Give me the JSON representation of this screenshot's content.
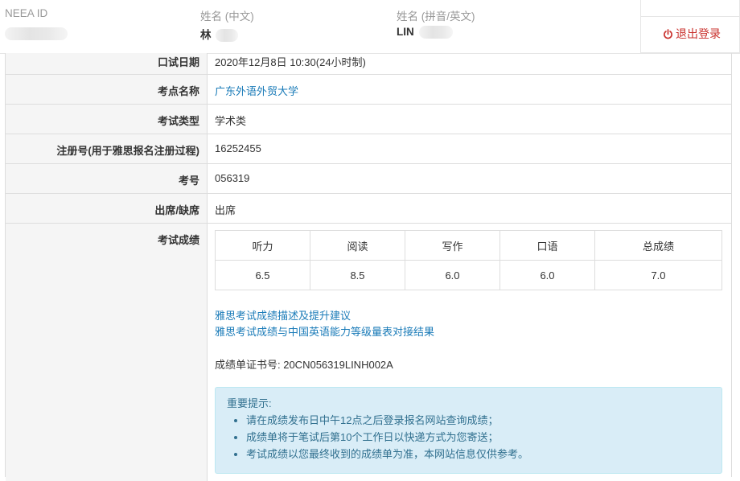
{
  "header": {
    "neea_id_label": "NEEA ID",
    "name_cn_label": "姓名 (中文)",
    "name_cn_value": "林",
    "name_en_label": "姓名 (拼音/英文)",
    "name_en_value": "LIN",
    "logout_label": "退出登录"
  },
  "details": {
    "test_date_label": "口试日期",
    "test_date_value": "2020年12月8日 10:30(24小时制)",
    "center_label": "考点名称",
    "center_value": "广东外语外贸大学",
    "type_label": "考试类型",
    "type_value": "学术类",
    "reg_label": "注册号(用于雅思报名注册过程)",
    "reg_value": "16252455",
    "candidate_label": "考号",
    "candidate_value": "056319",
    "attendance_label": "出席/缺席",
    "attendance_value": "出席",
    "scores_label": "考试成绩"
  },
  "scores": {
    "headers": [
      "听力",
      "阅读",
      "写作",
      "口语",
      "总成绩"
    ],
    "values": [
      "6.5",
      "8.5",
      "6.0",
      "6.0",
      "7.0"
    ]
  },
  "links": {
    "descriptors": "雅思考试成绩描述及提升建议",
    "cse": "雅思考试成绩与中国英语能力等级量表对接结果"
  },
  "trf": "成绩单证书号: 20CN056319LINH002A",
  "notice": {
    "title": "重要提示:",
    "items": [
      "请在成绩发布日中午12点之后登录报名网站查询成绩；",
      "成绩单将于笔试后第10个工作日以快递方式为您寄送；",
      "考试成绩以您最终收到的成绩单为准，本网站信息仅供参考。"
    ]
  },
  "colors": {
    "link": "#1a7bb8",
    "logout": "#c9302c",
    "notice_bg": "#d9edf7",
    "notice_text": "#31708f"
  }
}
